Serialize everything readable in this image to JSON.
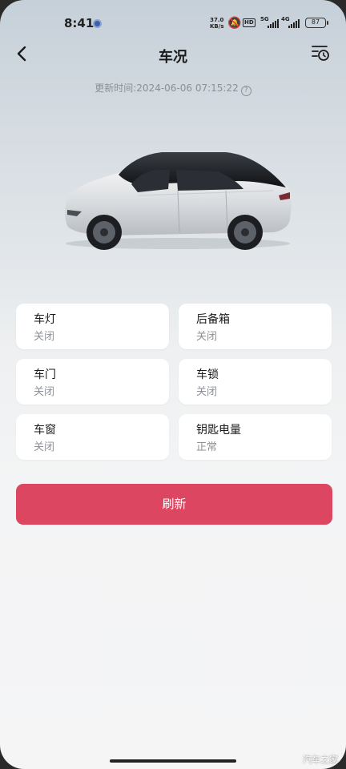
{
  "status_bar": {
    "time": "8:41",
    "net_speed_value": "37.0",
    "net_speed_unit": "KB/s",
    "hd_label": "HD",
    "signal_1_label": "5G",
    "signal_2_label": "4G",
    "battery_level": "87"
  },
  "header": {
    "title": "车况",
    "update_time": "更新时间:2024-06-06 07:15:22",
    "help_symbol": "?"
  },
  "status_cards": [
    {
      "label": "车灯",
      "value": "关闭"
    },
    {
      "label": "后备箱",
      "value": "关闭"
    },
    {
      "label": "车门",
      "value": "关闭"
    },
    {
      "label": "车锁",
      "value": "关闭"
    },
    {
      "label": "车窗",
      "value": "关闭"
    },
    {
      "label": "钥匙电量",
      "value": "正常"
    }
  ],
  "refresh_button": "刷新",
  "watermark": "汽车之家",
  "colors": {
    "accent": "#dc4661",
    "card_bg": "#ffffff",
    "secondary_text": "#8d9196"
  },
  "icons": {
    "back": "chevron-left-icon",
    "history": "history-list-icon",
    "help": "question-circle-icon"
  }
}
